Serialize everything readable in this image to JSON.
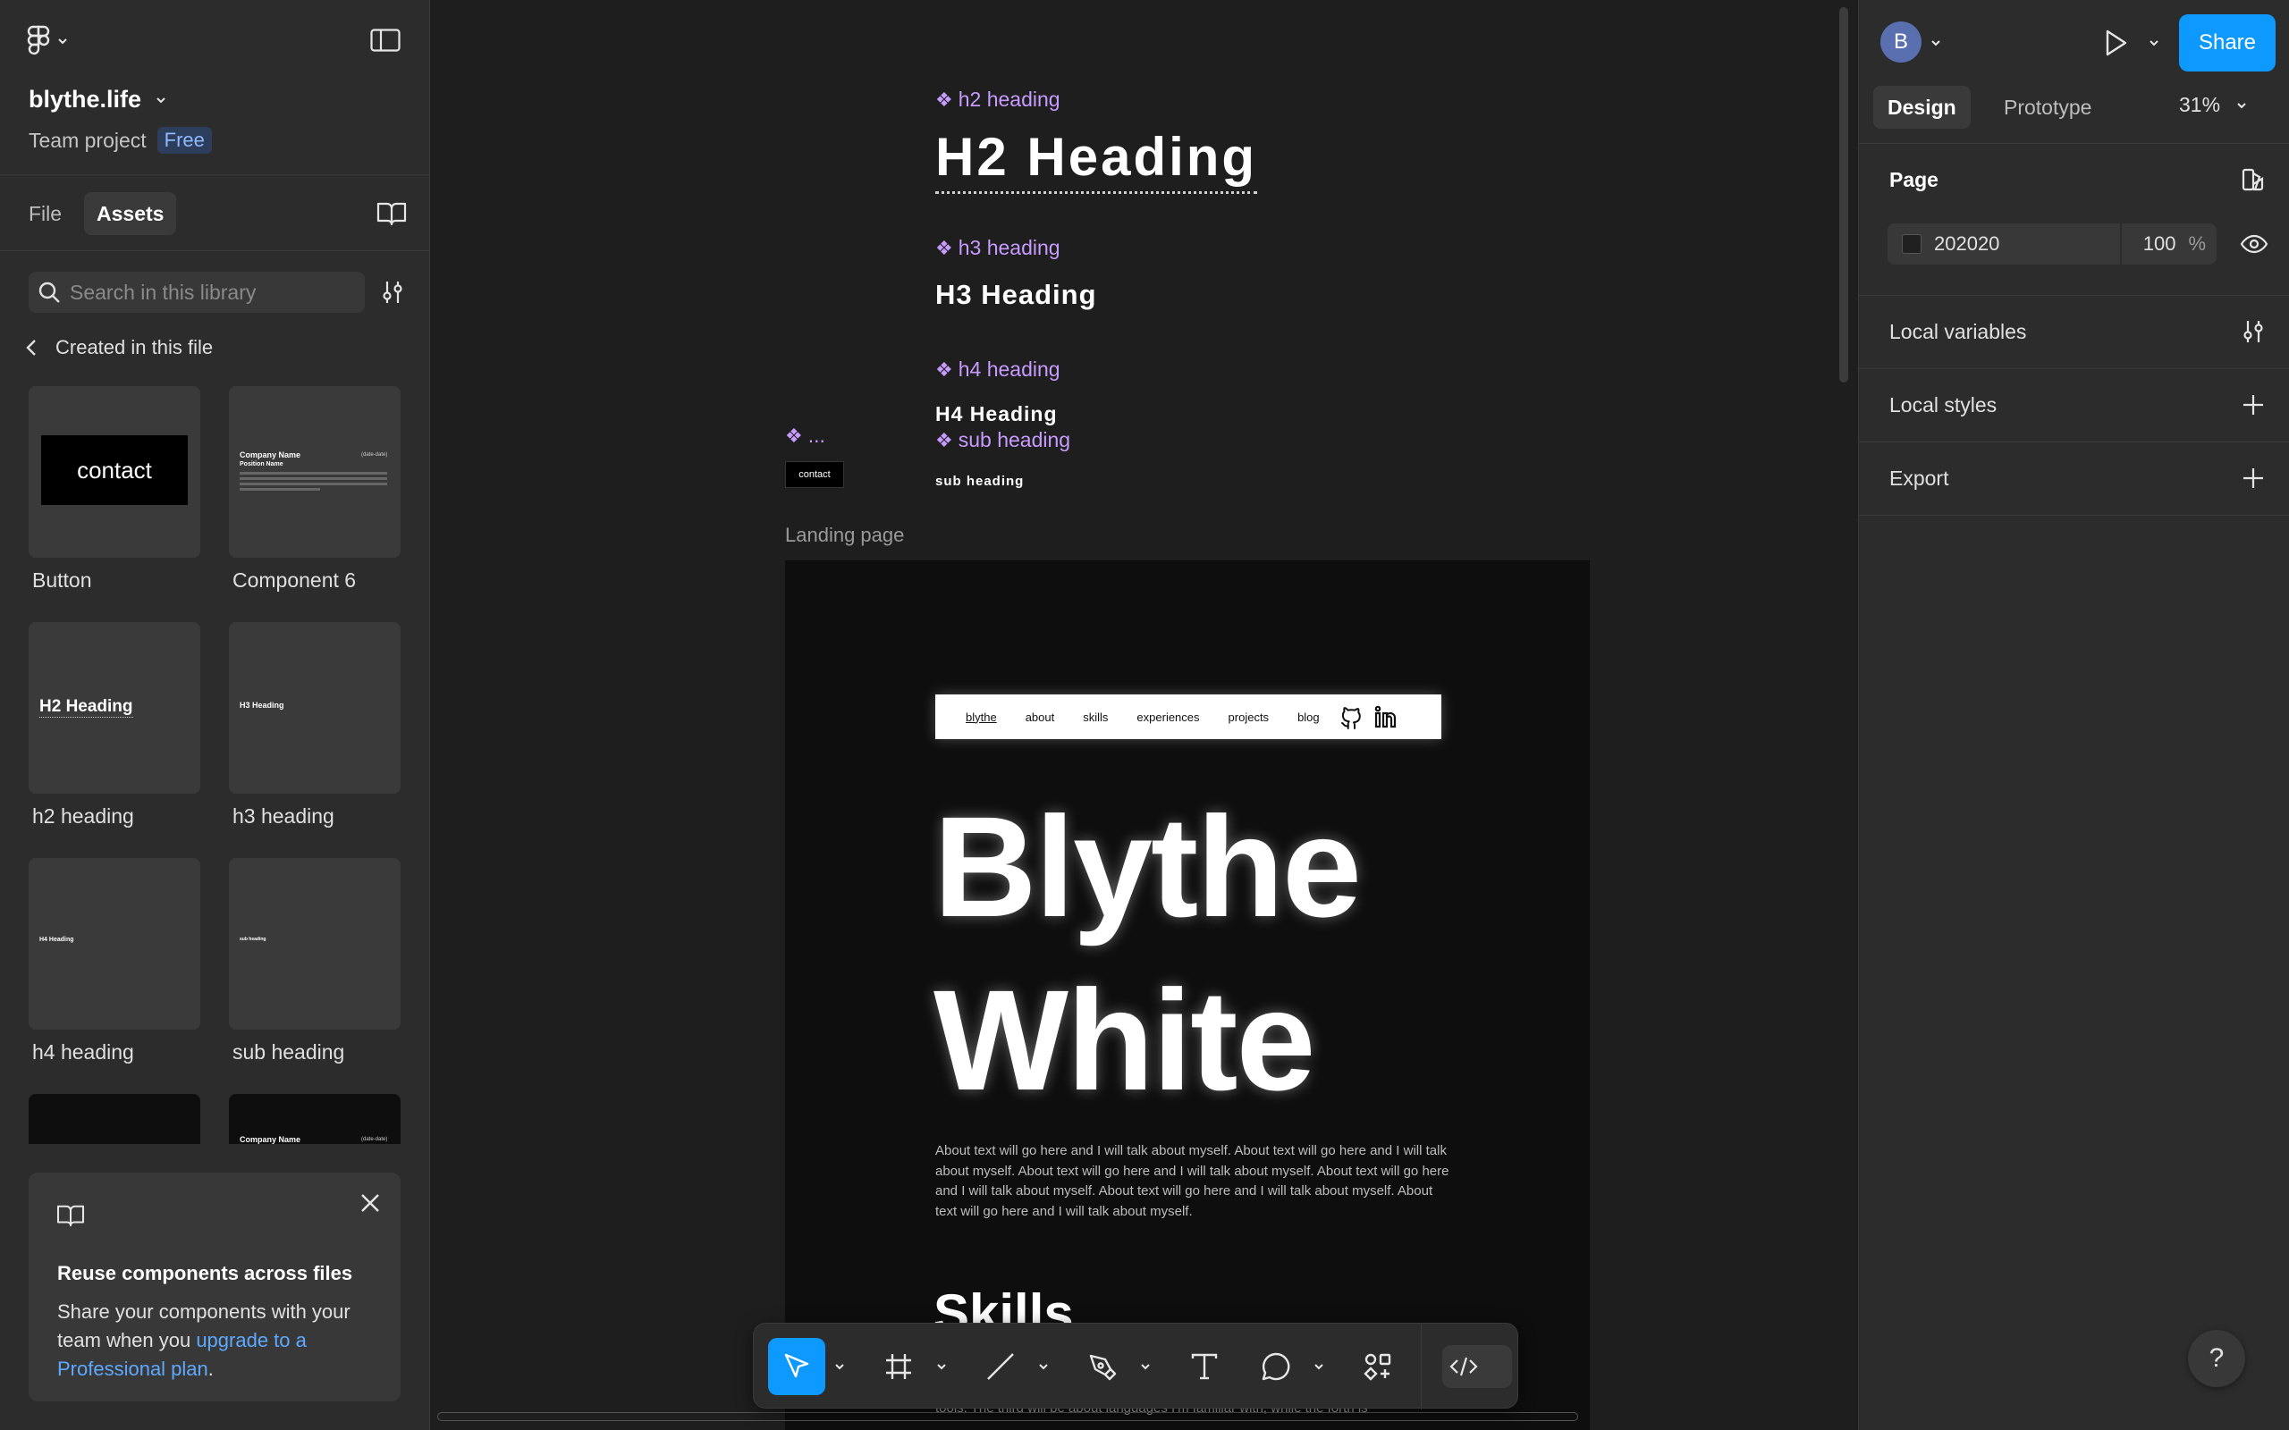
{
  "file": {
    "name": "blythe.life",
    "team_label": "Team project",
    "plan_badge": "Free"
  },
  "left_tabs": {
    "file": "File",
    "assets": "Assets"
  },
  "search": {
    "placeholder": "Search in this library"
  },
  "breadcrumb": {
    "label": "Created in this file"
  },
  "assets": [
    {
      "label": "Button",
      "preview_text": "contact"
    },
    {
      "label": "Component 6",
      "preview_company": "Company Name",
      "preview_position": "Position Name",
      "preview_dates": "(date-date)"
    },
    {
      "label": "h2 heading",
      "preview_text": "H2 Heading"
    },
    {
      "label": "h3 heading",
      "preview_text": "H3 Heading"
    },
    {
      "label": "h4 heading",
      "preview_text": "H4 Heading"
    },
    {
      "label": "sub heading",
      "preview_text": "sub heading"
    },
    {
      "label": "",
      "preview_text": ""
    },
    {
      "label": "",
      "preview_company": "Company Name",
      "preview_dates": "(date-date)"
    }
  ],
  "promo": {
    "title": "Reuse components across files",
    "text_before": "Share your components with your team when you ",
    "link_text": "upgrade to a Professional plan",
    "text_after": "."
  },
  "canvas": {
    "labels": {
      "h2": "h2 heading",
      "h3": "h3 heading",
      "h4": "h4 heading",
      "sub": "sub heading",
      "ellipsis": "..."
    },
    "h2_text": "H2 Heading",
    "h3_text": "H3 Heading",
    "h4_text": "H4 Heading",
    "sub_text": "sub heading",
    "mini_button": "contact",
    "frame_label": "Landing page",
    "nav_items": [
      "blythe",
      "about",
      "skills",
      "experiences",
      "projects",
      "blog"
    ],
    "hero_line1": "Blythe",
    "hero_line2": "White",
    "about_text": "About text will go here and I will talk about myself.  About text will go here and I will talk about myself.  About text will go here and I will talk about myself.  About text will go here and I will talk about myself.  About text will go here and I will talk about myself.  About text will go here and I will talk about myself.",
    "skills_heading": "Skills",
    "bottom_text": "tools.  The third will be about languages I'm familiar with, while the forth is"
  },
  "right_panel": {
    "avatar_initial": "B",
    "share": "Share",
    "tabs": {
      "design": "Design",
      "prototype": "Prototype"
    },
    "zoom": "31%",
    "page_section": "Page",
    "bg_color_hex": "202020",
    "bg_opacity": "100",
    "opacity_unit": "%",
    "local_variables": "Local variables",
    "local_styles": "Local styles",
    "export": "Export",
    "help": "?"
  },
  "colors": {
    "accent": "#0d99ff",
    "component_purple": "#c89bff",
    "page_bg": "#202020",
    "canvas_bg": "#1e1e1e",
    "panel_bg": "#2c2c2c"
  },
  "icons": [
    "figma-logo-icon",
    "chevron-down-icon",
    "sidebar-toggle-icon",
    "book-icon",
    "search-icon",
    "filter-icon",
    "chevron-left-icon",
    "close-icon",
    "component-icon",
    "github-icon",
    "linkedin-icon",
    "move-tool-icon",
    "frame-tool-icon",
    "line-tool-icon",
    "pen-tool-icon",
    "text-tool-icon",
    "comment-tool-icon",
    "actions-icon",
    "dev-mode-icon",
    "play-icon",
    "styles-icon",
    "eye-icon",
    "variables-icon",
    "plus-icon",
    "help-icon"
  ]
}
